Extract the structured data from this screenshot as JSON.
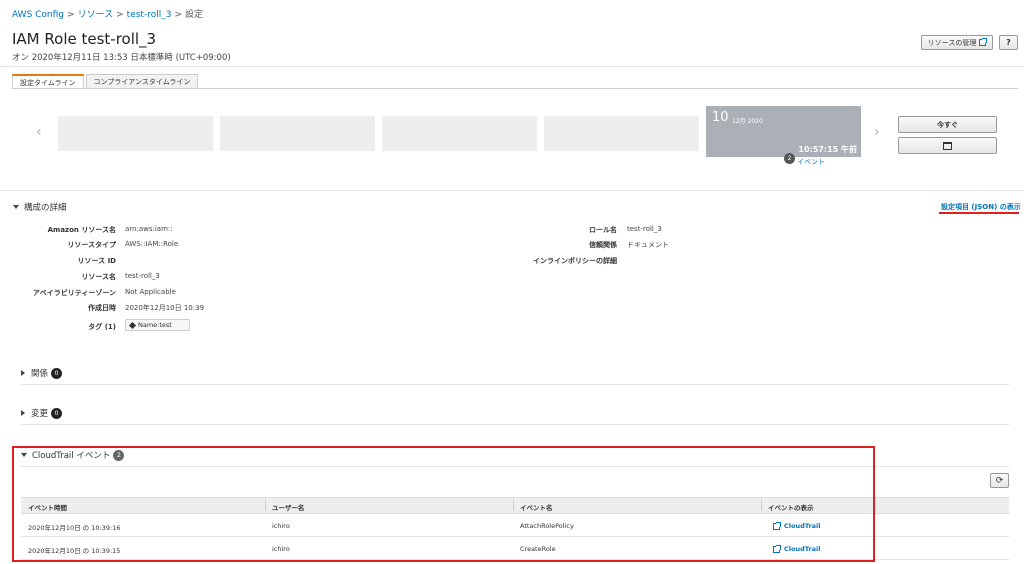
{
  "breadcrumb": {
    "root": "AWS Config",
    "resources": "リソース",
    "resource": "test-roll_3",
    "current": "設定",
    "sep": ">"
  },
  "header": {
    "title": "IAM Role test-roll_3",
    "subtitle": "オン 2020年12月11日 13:53 日本標準時 (UTC+09:00)",
    "manage_label": "リソースの管理",
    "help_label": "?"
  },
  "tabs": [
    {
      "label": "設定タイムライン",
      "active": true
    },
    {
      "label": "コンプライアンスタイムライン",
      "active": false
    }
  ],
  "timeline": {
    "day": "10",
    "month": "12月 2020",
    "time": "10:57:15 午前",
    "event_count": "2",
    "event_label": "イベント",
    "now_label": "今すぐ",
    "prev": "‹",
    "next": "›"
  },
  "config_details": {
    "title": "構成の詳細",
    "json_link": "設定項目 (JSON) の表示",
    "left": [
      {
        "label": "Amazon リソース名",
        "value": "arn:aws:iam::"
      },
      {
        "label": "リソースタイプ",
        "value": "AWS::IAM::Role"
      },
      {
        "label": "リソース ID",
        "value": ""
      },
      {
        "label": "リソース名",
        "value": "test-roll_3"
      },
      {
        "label": "アベイラビリティーゾーン",
        "value": "Not Applicable"
      },
      {
        "label": "作成日時",
        "value": "2020年12月10日 10:39"
      }
    ],
    "tags_label": "タグ (1)",
    "tag": "Name:test",
    "right": [
      {
        "label": "ロール名",
        "value": "test-roll_3"
      },
      {
        "label": "信頼関係",
        "value": "ドキュメント"
      },
      {
        "label": "インラインポリシーの詳細",
        "value": ""
      }
    ]
  },
  "relations": {
    "title": "関係",
    "count": "0"
  },
  "changes": {
    "title": "変更",
    "count": "0"
  },
  "cloudtrail": {
    "title": "CloudTrail イベント",
    "count": "2",
    "columns": [
      "イベント時間",
      "ユーザー名",
      "イベント名",
      "イベントの表示"
    ],
    "rows": [
      {
        "time": "2020年12月10日 の 10:39:16",
        "user": "ichiro",
        "event": "AttachRolePolicy",
        "link": "CloudTrail"
      },
      {
        "time": "2020年12月10日 の 10:39:15",
        "user": "ichiro",
        "event": "CreateRole",
        "link": "CloudTrail"
      }
    ]
  },
  "colors": {
    "link": "#0073bb",
    "highlight": "#e02020",
    "tab_accent": "#e47911"
  }
}
